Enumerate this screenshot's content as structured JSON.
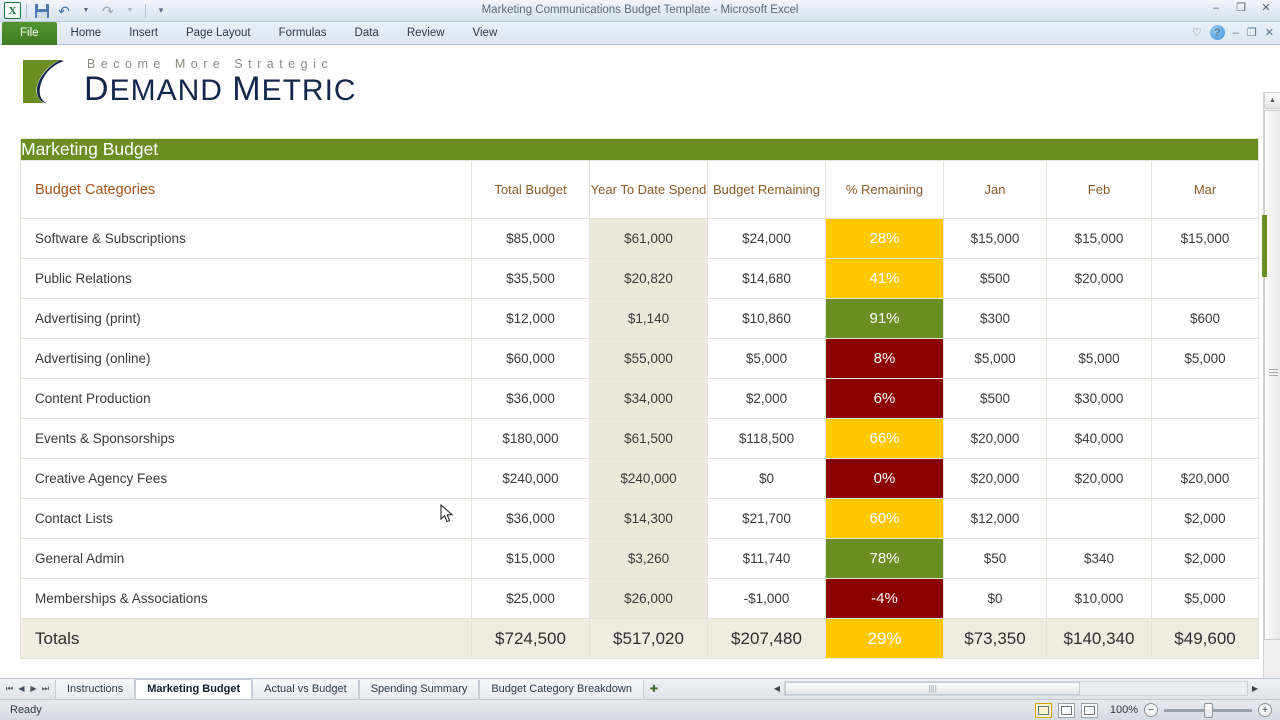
{
  "titlebar": {
    "document_title": "Marketing Communications Budget Template  -  Microsoft Excel",
    "app_icon": "excel-icon",
    "quick_access": [
      {
        "name": "save-icon",
        "label": "Save"
      },
      {
        "name": "undo-icon",
        "label": "↶"
      },
      {
        "name": "redo-icon",
        "label": "↷"
      },
      {
        "name": "customize-qat-icon",
        "label": "▾"
      }
    ],
    "window_controls": [
      {
        "name": "minimize-button",
        "glyph": "–"
      },
      {
        "name": "restore-button",
        "glyph": "❐"
      },
      {
        "name": "close-button",
        "glyph": "✕"
      }
    ]
  },
  "ribbon": {
    "tabs": [
      {
        "label": "File"
      },
      {
        "label": "Home"
      },
      {
        "label": "Insert"
      },
      {
        "label": "Page Layout"
      },
      {
        "label": "Formulas"
      },
      {
        "label": "Data"
      },
      {
        "label": "Review"
      },
      {
        "label": "View"
      }
    ],
    "right_controls": [
      {
        "name": "ribbon-options-icon",
        "glyph": "♡"
      },
      {
        "name": "help-icon",
        "glyph": "?"
      },
      {
        "name": "minimize-ribbon-button",
        "glyph": "–"
      },
      {
        "name": "restore-window-button",
        "glyph": "❐"
      },
      {
        "name": "close-window-button",
        "glyph": "✕"
      }
    ]
  },
  "logo": {
    "tagline": "Become More Strategic",
    "word1_cap": "D",
    "word1_rest": "EMAND",
    "word2_cap": "M",
    "word2_rest": "ETRIC",
    "colors": {
      "green": "#6b8e23",
      "navy": "#13264b",
      "tagline_gray": "#8a8d83"
    }
  },
  "sheet_title": "Marketing Budget",
  "colors": {
    "header_band": "#6b8e23",
    "accent_yellow": "#ffc800",
    "accent_green": "#6b8e23",
    "accent_red": "#8b0000",
    "ytd_column_bg": "#ebe9dc",
    "header_text": "#a5541d"
  },
  "chart_data": {
    "type": "table",
    "title": "Marketing Budget",
    "columns": [
      "Budget Categories",
      "Total Budget",
      "Year To Date Spend",
      "Budget Remaining",
      "% Remaining",
      "Jan",
      "Feb",
      "Mar"
    ],
    "rows": [
      {
        "category": "Software & Subscriptions",
        "total": "$85,000",
        "ytd": "$61,000",
        "remaining": "$24,000",
        "pct": "28%",
        "pct_color": "yellow",
        "jan": "$15,000",
        "feb": "$15,000",
        "mar": "$15,000"
      },
      {
        "category": "Public Relations",
        "total": "$35,500",
        "ytd": "$20,820",
        "remaining": "$14,680",
        "pct": "41%",
        "pct_color": "yellow",
        "jan": "$500",
        "feb": "$20,000",
        "mar": ""
      },
      {
        "category": "Advertising (print)",
        "total": "$12,000",
        "ytd": "$1,140",
        "remaining": "$10,860",
        "pct": "91%",
        "pct_color": "green",
        "jan": "$300",
        "feb": "",
        "mar": "$600"
      },
      {
        "category": "Advertising (online)",
        "total": "$60,000",
        "ytd": "$55,000",
        "remaining": "$5,000",
        "pct": "8%",
        "pct_color": "red",
        "jan": "$5,000",
        "feb": "$5,000",
        "mar": "$5,000"
      },
      {
        "category": "Content Production",
        "total": "$36,000",
        "ytd": "$34,000",
        "remaining": "$2,000",
        "pct": "6%",
        "pct_color": "red",
        "jan": "$500",
        "feb": "$30,000",
        "mar": ""
      },
      {
        "category": "Events & Sponsorships",
        "total": "$180,000",
        "ytd": "$61,500",
        "remaining": "$118,500",
        "pct": "66%",
        "pct_color": "yellow",
        "jan": "$20,000",
        "feb": "$40,000",
        "mar": ""
      },
      {
        "category": "Creative Agency Fees",
        "total": "$240,000",
        "ytd": "$240,000",
        "remaining": "$0",
        "pct": "0%",
        "pct_color": "red",
        "jan": "$20,000",
        "feb": "$20,000",
        "mar": "$20,000"
      },
      {
        "category": "Contact Lists",
        "total": "$36,000",
        "ytd": "$14,300",
        "remaining": "$21,700",
        "pct": "60%",
        "pct_color": "yellow",
        "jan": "$12,000",
        "feb": "",
        "mar": "$2,000"
      },
      {
        "category": "General Admin",
        "total": "$15,000",
        "ytd": "$3,260",
        "remaining": "$11,740",
        "pct": "78%",
        "pct_color": "green",
        "jan": "$50",
        "feb": "$340",
        "mar": "$2,000"
      },
      {
        "category": "Memberships & Associations",
        "total": "$25,000",
        "ytd": "$26,000",
        "remaining": "-$1,000",
        "pct": "-4%",
        "pct_color": "red",
        "jan": "$0",
        "feb": "$10,000",
        "mar": "$5,000"
      }
    ],
    "totals": {
      "category": "Totals",
      "total": "$724,500",
      "ytd": "$517,020",
      "remaining": "$207,480",
      "pct": "29%",
      "pct_color": "yellow",
      "jan": "$73,350",
      "feb": "$140,340",
      "mar": "$49,600"
    }
  },
  "sheet_tabs": {
    "nav": [
      {
        "name": "first-sheet-button",
        "glyph": "⏮"
      },
      {
        "name": "prev-sheet-button",
        "glyph": "◀"
      },
      {
        "name": "next-sheet-button",
        "glyph": "▶"
      },
      {
        "name": "last-sheet-button",
        "glyph": "⏭"
      }
    ],
    "tabs": [
      {
        "label": "Instructions",
        "active": false
      },
      {
        "label": "Marketing Budget",
        "active": true
      },
      {
        "label": "Actual vs Budget",
        "active": false
      },
      {
        "label": "Spending Summary",
        "active": false
      },
      {
        "label": "Budget Category Breakdown",
        "active": false
      }
    ],
    "new_sheet_glyph": "➕"
  },
  "statusbar": {
    "status": "Ready",
    "views": [
      {
        "name": "normal-view-button",
        "selected": true
      },
      {
        "name": "page-layout-view-button",
        "selected": false
      },
      {
        "name": "page-break-preview-button",
        "selected": false
      }
    ],
    "zoom_out_glyph": "−",
    "zoom_in_glyph": "+",
    "zoom_level": "100%"
  }
}
